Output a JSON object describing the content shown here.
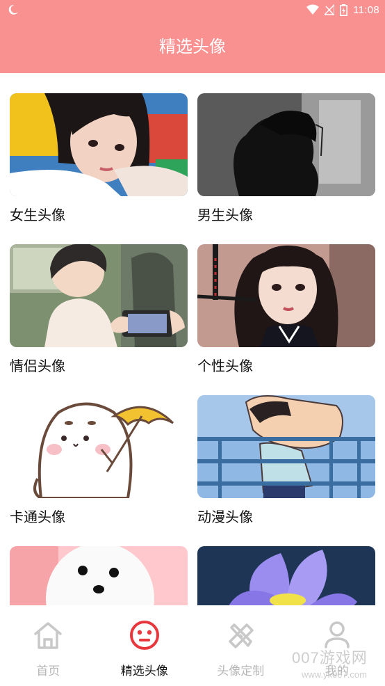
{
  "status_bar": {
    "time": "11:08"
  },
  "header": {
    "title": "精选头像"
  },
  "categories": [
    {
      "label": "女生头像"
    },
    {
      "label": "男生头像"
    },
    {
      "label": "情侣头像"
    },
    {
      "label": "个性头像"
    },
    {
      "label": "卡通头像"
    },
    {
      "label": "动漫头像"
    },
    {
      "label": ""
    },
    {
      "label": ""
    }
  ],
  "bottom_nav": {
    "items": [
      {
        "label": "首页",
        "icon": "home-icon",
        "active": false
      },
      {
        "label": "精选头像",
        "icon": "face-icon",
        "active": true
      },
      {
        "label": "头像定制",
        "icon": "tools-icon",
        "active": false
      },
      {
        "label": "我的",
        "icon": "person-icon",
        "active": false
      }
    ]
  },
  "watermark": {
    "text": "007游戏网",
    "url": "www.yx007.com"
  },
  "colors": {
    "header": "#f99191",
    "active_icon": "#e8383d",
    "inactive": "#b5b5b5"
  }
}
